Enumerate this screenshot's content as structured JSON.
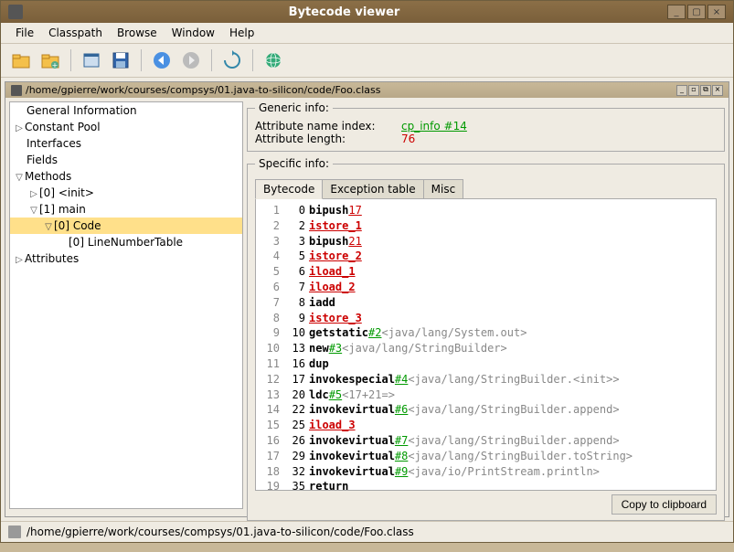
{
  "title": "Bytecode viewer",
  "menubar": {
    "file": "File",
    "classpath": "Classpath",
    "browse": "Browse",
    "window": "Window",
    "help": "Help"
  },
  "subwindow_path": "/home/gpierre/work/courses/compsys/01.java-to-silicon/code/Foo.class",
  "tree": {
    "general_info": "General Information",
    "constant_pool": "Constant Pool",
    "interfaces": "Interfaces",
    "fields": "Fields",
    "methods": "Methods",
    "init": "[0] <init>",
    "main": "[1] main",
    "code": "[0] Code",
    "lnt": "[0] LineNumberTable",
    "attributes": "Attributes"
  },
  "generic_info": {
    "legend": "Generic info:",
    "attr_name_label": "Attribute name index:",
    "attr_name_value": "cp_info #14",
    "attr_len_label": "Attribute length:",
    "attr_len_value": "76"
  },
  "specific_info": {
    "legend": "Specific info:",
    "tabs": {
      "bytecode": "Bytecode",
      "exception": "Exception table",
      "misc": "Misc"
    },
    "copy_btn": "Copy to clipboard"
  },
  "bytecode": [
    {
      "ln": 1,
      "off": "0",
      "op": "bipush",
      "arg_red": "17"
    },
    {
      "ln": 2,
      "off": "2",
      "op": "istore_1",
      "u": true
    },
    {
      "ln": 3,
      "off": "3",
      "op": "bipush",
      "arg_red": "21"
    },
    {
      "ln": 4,
      "off": "5",
      "op": "istore_2",
      "u": true
    },
    {
      "ln": 5,
      "off": "6",
      "op": "iload_1",
      "u": true
    },
    {
      "ln": 6,
      "off": "7",
      "op": "iload_2",
      "u": true
    },
    {
      "ln": 7,
      "off": "8",
      "op": "iadd"
    },
    {
      "ln": 8,
      "off": "9",
      "op": "istore_3",
      "u": true
    },
    {
      "ln": 9,
      "off": "10",
      "op": "getstatic",
      "ref": "#2",
      "cmt": "<java/lang/System.out>"
    },
    {
      "ln": 10,
      "off": "13",
      "op": "new",
      "ref": "#3",
      "cmt": "<java/lang/StringBuilder>"
    },
    {
      "ln": 11,
      "off": "16",
      "op": "dup"
    },
    {
      "ln": 12,
      "off": "17",
      "op": "invokespecial",
      "ref": "#4",
      "cmt": "<java/lang/StringBuilder.<init>>"
    },
    {
      "ln": 13,
      "off": "20",
      "op": "ldc",
      "ref": "#5",
      "cmt": "<17+21=>"
    },
    {
      "ln": 14,
      "off": "22",
      "op": "invokevirtual",
      "ref": "#6",
      "cmt": "<java/lang/StringBuilder.append>"
    },
    {
      "ln": 15,
      "off": "25",
      "op": "iload_3",
      "u": true
    },
    {
      "ln": 16,
      "off": "26",
      "op": "invokevirtual",
      "ref": "#7",
      "cmt": "<java/lang/StringBuilder.append>"
    },
    {
      "ln": 17,
      "off": "29",
      "op": "invokevirtual",
      "ref": "#8",
      "cmt": "<java/lang/StringBuilder.toString>"
    },
    {
      "ln": 18,
      "off": "32",
      "op": "invokevirtual",
      "ref": "#9",
      "cmt": "<java/io/PrintStream.println>"
    },
    {
      "ln": 19,
      "off": "35",
      "op": "return"
    }
  ],
  "statusbar": "/home/gpierre/work/courses/compsys/01.java-to-silicon/code/Foo.class"
}
